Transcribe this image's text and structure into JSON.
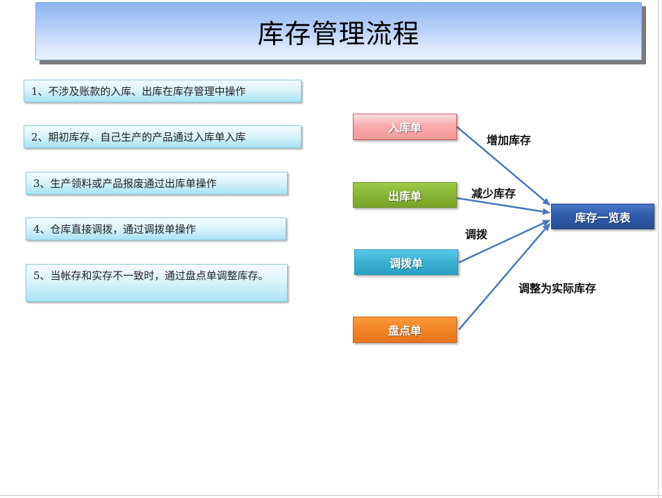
{
  "title": "库存管理流程",
  "notes": [
    "1、不涉及账款的入库、出库在库存管理中操作",
    "2、期初库存、自己生产的产品通过入库单入库",
    "3、生产领料或产品报废通过出库单操作",
    "4、仓库直接调拨，通过调拨单操作",
    "5、当帐存和实存不一致时，通过盘点单调整库存。"
  ],
  "nodes": {
    "inbound": "入库单",
    "outbound": "出库单",
    "transfer": "调拨单",
    "count": "盘点单",
    "summary": "库存一览表"
  },
  "edge_labels": {
    "inbound": "增加库存",
    "outbound": "减少库存",
    "transfer": "调拨",
    "count": "调整为实际库存"
  },
  "colors": {
    "arrow": "#4a78bd",
    "inbound": "#f39a9a",
    "outbound": "#86b535",
    "transfer": "#3bb1d4",
    "count": "#f28524",
    "summary": "#2f5ba9"
  }
}
